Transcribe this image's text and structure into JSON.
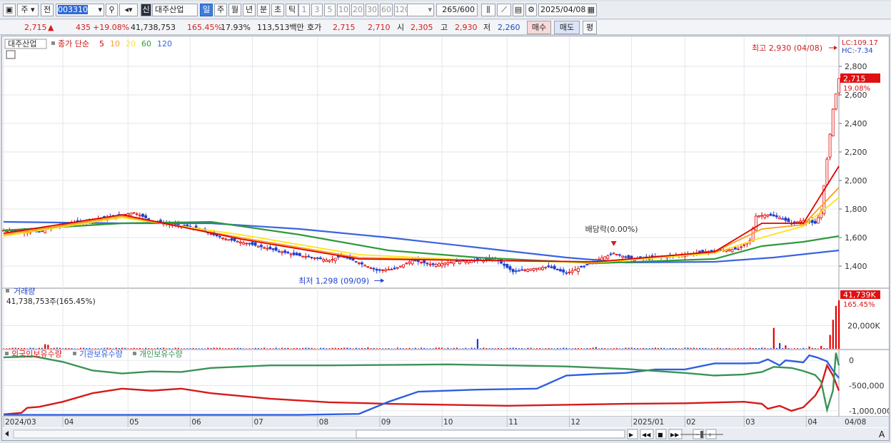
{
  "toolbar": {
    "market": "주",
    "prev": "전",
    "code": "003310",
    "badge": "신",
    "stock_name": "대주산업",
    "periods": [
      "일",
      "주",
      "월",
      "년",
      "분",
      "초",
      "틱"
    ],
    "selected_period": "일",
    "intervals": [
      "1",
      "3",
      "5",
      "10",
      "20",
      "30",
      "60",
      "120"
    ],
    "count": "265",
    "count_total": "/600",
    "date": "2025/04/08"
  },
  "quote": {
    "price": "2,715",
    "change": "435",
    "change_pct": "+19.08%",
    "volume": "41,738,753",
    "volume_ratio": "165.45%",
    "turnover": "17.93%",
    "amount": "113,513백만",
    "bid_label": "호가",
    "ask": "2,715",
    "bid": "2,710",
    "open_label": "시",
    "open": "2,305",
    "high_label": "고",
    "high": "2,930",
    "low_label": "저",
    "low": "2,260",
    "buy_button": "매수",
    "sell_button": "매도",
    "eval_button": "평"
  },
  "colors": {
    "up": "#e00000",
    "down": "#1f3fd1",
    "ma5": "#e00000",
    "ma10": "#ff9d1a",
    "ma20": "#ffe21a",
    "ma60": "#2e9a3c",
    "ma120": "#3a64e0",
    "foreign": "#d61a1a",
    "institution": "#2f5fe0",
    "individual": "#3b9356"
  },
  "chart_data": [
    {
      "type": "candlestick",
      "legend": {
        "name": "대주산업",
        "ma_label": "종가 단순",
        "periods": [
          "5",
          "10",
          "20",
          "60",
          "120"
        ]
      },
      "ylim": [
        1250,
        3000
      ],
      "yticks": [
        1400,
        1600,
        1800,
        2000,
        2200,
        2400,
        2600,
        2800
      ],
      "ytick_labels": [
        "1,400",
        "1,600",
        "1,800",
        "2,000",
        "2,200",
        "2,400",
        "2,600",
        "2,800"
      ],
      "right_labels": {
        "lc": "LC:109.17",
        "hc": "HC:-7.34",
        "price": "2,715",
        "pct": "19.08%"
      },
      "annotations": {
        "high": "최고 2,930 (04/08)",
        "low": "최저 1,298 (09/09)",
        "dividend": "배당락(0.00%)"
      },
      "price_path": [
        [
          0,
          1650
        ],
        [
          12,
          1640
        ],
        [
          20,
          1690
        ],
        [
          28,
          1720
        ],
        [
          36,
          1745
        ],
        [
          44,
          1775
        ],
        [
          50,
          1720
        ],
        [
          56,
          1690
        ],
        [
          62,
          1680
        ],
        [
          68,
          1640
        ],
        [
          75,
          1590
        ],
        [
          82,
          1560
        ],
        [
          90,
          1520
        ],
        [
          98,
          1480
        ],
        [
          104,
          1460
        ],
        [
          110,
          1440
        ],
        [
          114,
          1470
        ],
        [
          118,
          1440
        ],
        [
          126,
          1370
        ],
        [
          132,
          1380
        ],
        [
          138,
          1440
        ],
        [
          145,
          1410
        ],
        [
          152,
          1430
        ],
        [
          160,
          1440
        ],
        [
          166,
          1450
        ],
        [
          172,
          1360
        ],
        [
          178,
          1380
        ],
        [
          184,
          1395
        ],
        [
          190,
          1350
        ],
        [
          196,
          1400
        ],
        [
          200,
          1440
        ],
        [
          206,
          1490
        ],
        [
          212,
          1450
        ],
        [
          218,
          1460
        ],
        [
          224,
          1470
        ],
        [
          230,
          1480
        ],
        [
          236,
          1500
        ],
        [
          242,
          1510
        ],
        [
          248,
          1520
        ],
        [
          252,
          1580
        ],
        [
          254,
          1750
        ],
        [
          258,
          1760
        ],
        [
          262,
          1740
        ],
        [
          266,
          1700
        ],
        [
          270,
          1720
        ],
        [
          274,
          1700
        ],
        [
          276,
          1780
        ],
        [
          278,
          2150
        ],
        [
          280,
          2500
        ],
        [
          282,
          2715
        ]
      ],
      "ma_paths": {
        "5": [
          [
            0,
            1630
          ],
          [
            40,
            1760
          ],
          [
            80,
            1590
          ],
          [
            120,
            1450
          ],
          [
            160,
            1440
          ],
          [
            200,
            1430
          ],
          [
            240,
            1500
          ],
          [
            256,
            1700
          ],
          [
            270,
            1700
          ],
          [
            282,
            2100
          ]
        ],
        "10": [
          [
            0,
            1620
          ],
          [
            40,
            1750
          ],
          [
            80,
            1600
          ],
          [
            120,
            1460
          ],
          [
            160,
            1440
          ],
          [
            200,
            1430
          ],
          [
            240,
            1500
          ],
          [
            256,
            1660
          ],
          [
            270,
            1690
          ],
          [
            282,
            1950
          ]
        ],
        "20": [
          [
            0,
            1610
          ],
          [
            40,
            1740
          ],
          [
            80,
            1620
          ],
          [
            120,
            1480
          ],
          [
            160,
            1440
          ],
          [
            200,
            1425
          ],
          [
            240,
            1490
          ],
          [
            256,
            1600
          ],
          [
            270,
            1680
          ],
          [
            282,
            1880
          ]
        ],
        "60": [
          [
            0,
            1650
          ],
          [
            40,
            1700
          ],
          [
            70,
            1710
          ],
          [
            100,
            1620
          ],
          [
            130,
            1510
          ],
          [
            160,
            1460
          ],
          [
            200,
            1420
          ],
          [
            240,
            1450
          ],
          [
            256,
            1540
          ],
          [
            270,
            1570
          ],
          [
            282,
            1610
          ]
        ],
        "120": [
          [
            0,
            1710
          ],
          [
            40,
            1700
          ],
          [
            70,
            1700
          ],
          [
            100,
            1660
          ],
          [
            130,
            1600
          ],
          [
            160,
            1530
          ],
          [
            190,
            1460
          ],
          [
            210,
            1425
          ],
          [
            240,
            1430
          ],
          [
            260,
            1460
          ],
          [
            282,
            1510
          ]
        ]
      }
    },
    {
      "type": "bar",
      "title": "거래량",
      "value_label": "41,738,753주(165.45%)",
      "right_labels": {
        "value": "41,739K",
        "pct": "165.45%"
      },
      "yticks": [
        20000
      ],
      "ytick_labels": [
        "20,000K"
      ],
      "ylim": [
        0,
        43000
      ],
      "volume_spikes": [
        [
          14,
          4000
        ],
        [
          15,
          3500
        ],
        [
          123,
          1200
        ],
        [
          160,
          8500
        ],
        [
          200,
          1500
        ],
        [
          260,
          18000
        ],
        [
          262,
          5000
        ],
        [
          264,
          3000
        ],
        [
          272,
          2000
        ],
        [
          276,
          2500
        ],
        [
          279,
          12000
        ],
        [
          280,
          25000
        ],
        [
          281,
          37000
        ],
        [
          282,
          41739
        ]
      ]
    },
    {
      "type": "line",
      "legend": [
        "외국인보유수량",
        "기관보유수량",
        "개인보유수량"
      ],
      "ylim": [
        -1100000,
        200000
      ],
      "yticks": [
        0,
        -500000,
        -1000000
      ],
      "ytick_labels": [
        "0",
        "-500,000",
        "-1,000,000"
      ],
      "x_ticks": [
        "2024/03",
        "04",
        "05",
        "06",
        "07",
        "08",
        "09",
        "10",
        "11",
        "12",
        "2025/01",
        "02",
        "03",
        "04"
      ],
      "x_end_label": "04/08",
      "series": [
        {
          "name": "외국인보유수량",
          "values": [
            [
              0,
              -1070000
            ],
            [
              6,
              -1040000
            ],
            [
              8,
              -940000
            ],
            [
              12,
              -920000
            ],
            [
              20,
              -820000
            ],
            [
              30,
              -650000
            ],
            [
              40,
              -560000
            ],
            [
              50,
              -600000
            ],
            [
              60,
              -560000
            ],
            [
              70,
              -650000
            ],
            [
              90,
              -760000
            ],
            [
              110,
              -830000
            ],
            [
              130,
              -860000
            ],
            [
              150,
              -880000
            ],
            [
              170,
              -900000
            ],
            [
              190,
              -880000
            ],
            [
              210,
              -860000
            ],
            [
              230,
              -850000
            ],
            [
              250,
              -820000
            ],
            [
              256,
              -860000
            ],
            [
              258,
              -960000
            ],
            [
              262,
              -900000
            ],
            [
              266,
              -1000000
            ],
            [
              270,
              -930000
            ],
            [
              274,
              -700000
            ],
            [
              276,
              -500000
            ],
            [
              278,
              -100000
            ],
            [
              280,
              -300000
            ],
            [
              282,
              -600000
            ]
          ]
        },
        {
          "name": "기관보유수량",
          "values": [
            [
              0,
              -1080000
            ],
            [
              50,
              -1080000
            ],
            [
              100,
              -1080000
            ],
            [
              120,
              -1060000
            ],
            [
              130,
              -820000
            ],
            [
              140,
              -620000
            ],
            [
              160,
              -580000
            ],
            [
              180,
              -560000
            ],
            [
              190,
              -300000
            ],
            [
              200,
              -270000
            ],
            [
              210,
              -250000
            ],
            [
              220,
              -180000
            ],
            [
              230,
              -180000
            ],
            [
              240,
              -60000
            ],
            [
              250,
              -60000
            ],
            [
              255,
              -50000
            ],
            [
              258,
              20000
            ],
            [
              262,
              -100000
            ],
            [
              264,
              0
            ],
            [
              270,
              -40000
            ],
            [
              272,
              100000
            ],
            [
              275,
              50000
            ],
            [
              278,
              -20000
            ],
            [
              280,
              -200000
            ],
            [
              282,
              -350000
            ]
          ]
        },
        {
          "name": "개인보유수량",
          "values": [
            [
              0,
              60000
            ],
            [
              10,
              80000
            ],
            [
              20,
              -30000
            ],
            [
              30,
              -200000
            ],
            [
              40,
              -260000
            ],
            [
              50,
              -220000
            ],
            [
              60,
              -230000
            ],
            [
              70,
              -150000
            ],
            [
              90,
              -100000
            ],
            [
              110,
              -100000
            ],
            [
              130,
              -90000
            ],
            [
              150,
              -80000
            ],
            [
              170,
              -100000
            ],
            [
              190,
              -120000
            ],
            [
              210,
              -170000
            ],
            [
              230,
              -250000
            ],
            [
              240,
              -300000
            ],
            [
              250,
              -280000
            ],
            [
              256,
              -230000
            ],
            [
              260,
              -130000
            ],
            [
              266,
              -150000
            ],
            [
              270,
              -210000
            ],
            [
              274,
              -290000
            ],
            [
              276,
              -420000
            ],
            [
              278,
              -980000
            ],
            [
              280,
              -600000
            ],
            [
              281,
              150000
            ],
            [
              282,
              -100000
            ]
          ]
        }
      ]
    }
  ],
  "bottom": {
    "icons": [
      "play-icon",
      "rewind-icon",
      "stop-icon",
      "forward-icon",
      "zoom-minus-icon",
      "zoom-plus-icon"
    ],
    "font_button": "A"
  }
}
